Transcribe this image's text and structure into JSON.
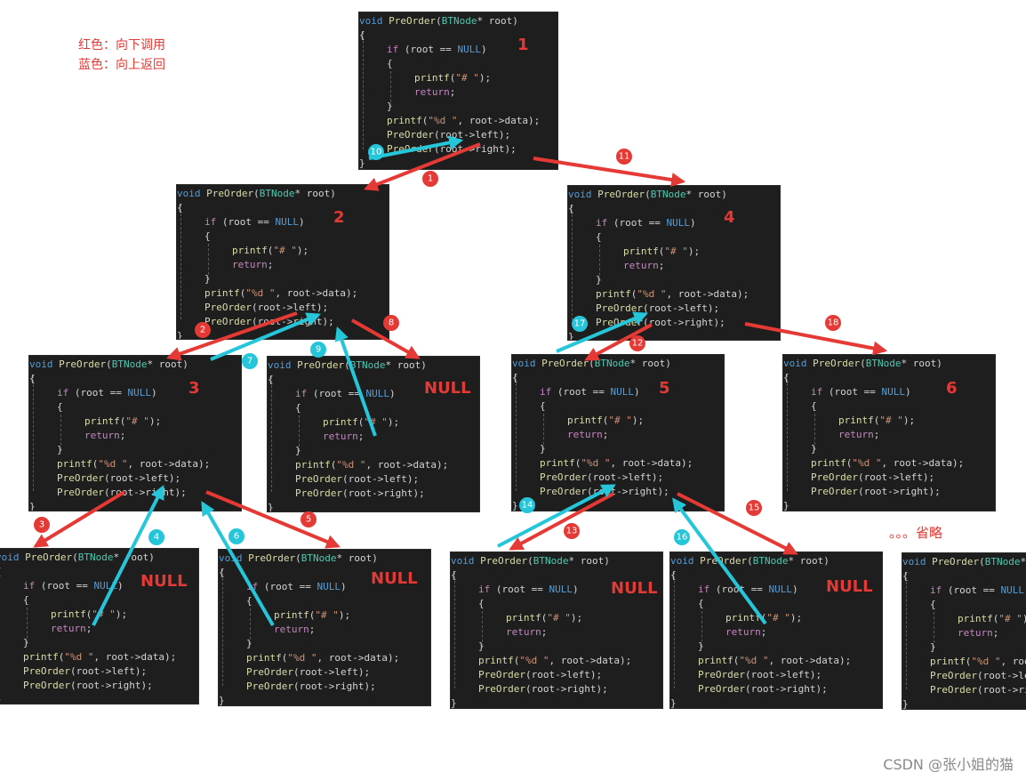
{
  "legend": {
    "red": "红色：向下调用",
    "blue": "蓝色：向上返回"
  },
  "colors": {
    "call_arrow": "#e53935",
    "return_arrow": "#26c6da",
    "code_bg": "#1e1e1e"
  },
  "code": {
    "sig": {
      "void": "void",
      "name": "PreOrder",
      "type": "BTNode",
      "rest": "* root)"
    },
    "open_brace": "{",
    "close_brace": "}",
    "if_kw": "if",
    "if_rest_a": " (root == ",
    "null_kw": "NULL",
    "if_rest_b": ")",
    "printf_kw": "printf",
    "hash_str": "\"# \"",
    "printf_end": ");",
    "return_kw": "return",
    "semi": ";",
    "fmt_str": "\"%d \"",
    "data_rest": ", root->data);",
    "left_call": "(root->left);",
    "right_call": "(root->right);",
    "paren_open": "("
  },
  "nodes": [
    {
      "tag": "1"
    },
    {
      "tag": "2"
    },
    {
      "tag": "4"
    },
    {
      "tag": "3"
    },
    {
      "tag": "NULL"
    },
    {
      "tag": "5"
    },
    {
      "tag": "6"
    },
    {
      "tag": "NULL"
    },
    {
      "tag": "NULL"
    },
    {
      "tag": "NULL"
    },
    {
      "tag": "NULL"
    },
    {
      "tag": ""
    }
  ],
  "ellipsis": "。。。省略",
  "steps": [
    "1",
    "2",
    "3",
    "4",
    "5",
    "6",
    "7",
    "8",
    "9",
    "10",
    "11",
    "12",
    "13",
    "14",
    "15",
    "16",
    "17",
    "18"
  ],
  "watermark": "CSDN @张小姐的猫"
}
